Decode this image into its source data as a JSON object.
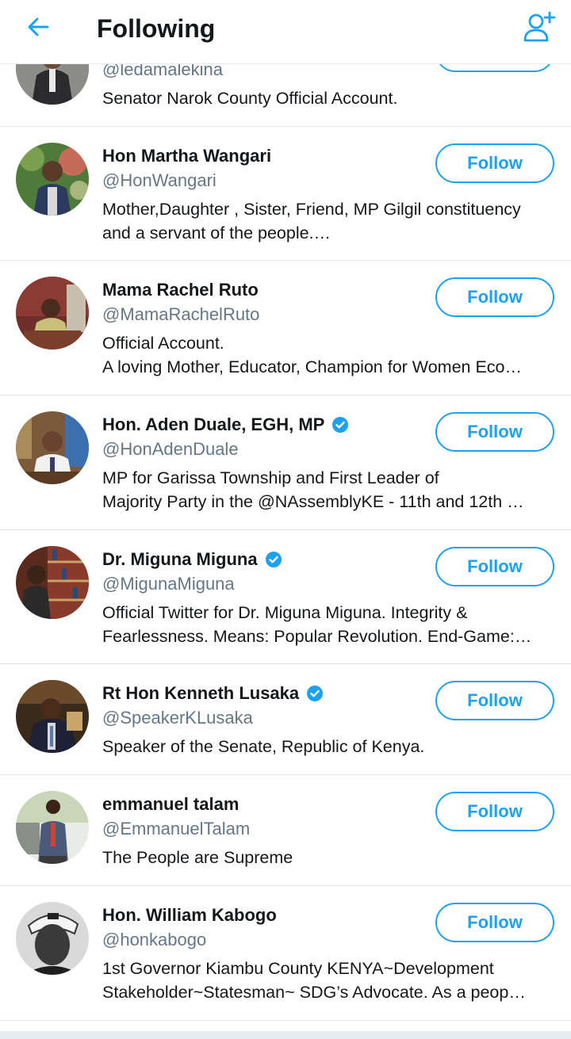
{
  "header": {
    "title": "Following",
    "back_icon": "arrow-left-icon",
    "add_icon": "add-user-icon",
    "accent": "#1da1f2"
  },
  "follow_label": "Follow",
  "users": [
    {
      "name": "",
      "handle": "@ledamalekina",
      "verified": false,
      "bio": [
        "Senator Narok County Official Account."
      ],
      "has_button": true
    },
    {
      "name": "Hon Martha Wangari",
      "handle": "@HonWangari",
      "verified": false,
      "bio": [
        "Mother,Daughter , Sister, Friend, MP Gilgil constituency",
        "and a servant of the people.…"
      ],
      "has_button": true
    },
    {
      "name": "Mama Rachel Ruto",
      "handle": "@MamaRachelRuto",
      "verified": false,
      "bio": [
        "Official Account.",
        "A loving Mother, Educator, Champion for Women Eco…"
      ],
      "has_button": true
    },
    {
      "name": "Hon. Aden Duale, EGH, MP",
      "handle": "@HonAdenDuale",
      "verified": true,
      "bio": [
        "MP for Garissa Township and First Leader of",
        "Majority Party in the @NAssemblyKE - 11th and 12th …"
      ],
      "has_button": true
    },
    {
      "name": "Dr. Miguna Miguna",
      "handle": "@MigunaMiguna",
      "verified": true,
      "bio": [
        "Official Twitter for Dr. Miguna Miguna. Integrity &",
        "Fearlessness. Means: Popular Revolution. End-Game:…"
      ],
      "has_button": true
    },
    {
      "name": "Rt Hon Kenneth Lusaka",
      "handle": "@SpeakerKLusaka",
      "verified": true,
      "bio": [
        "Speaker of the Senate, Republic of Kenya."
      ],
      "has_button": true
    },
    {
      "name": "emmanuel talam",
      "handle": "@EmmanuelTalam",
      "verified": false,
      "bio": [
        "The People are Supreme"
      ],
      "has_button": true
    },
    {
      "name": "Hon. William Kabogo",
      "handle": "@honkabogo",
      "verified": false,
      "bio": [
        "1st Governor Kiambu County KENYA~Development",
        "Stakeholder~Statesman~ SDG’s Advocate. As a peop…"
      ],
      "has_button": true
    }
  ]
}
